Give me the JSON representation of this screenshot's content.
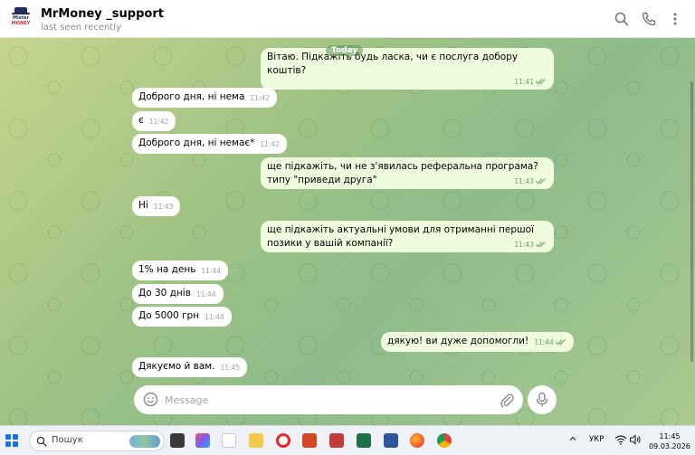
{
  "header": {
    "avatar_text_top": "Mister",
    "avatar_text_bottom": "MONEY",
    "title": "MrMoney _support",
    "status": "last seen recently"
  },
  "chat": {
    "date_chip": "Today",
    "messages": [
      {
        "dir": "out",
        "text": "Вітаю. Підкажіть будь ласка, чи є послуга добору коштів?",
        "time": "11:41"
      },
      {
        "dir": "in",
        "text": "Доброго дня, ні нема",
        "time": "11:42"
      },
      {
        "dir": "in",
        "text": "є",
        "time": "11:42"
      },
      {
        "dir": "in",
        "text": "Доброго дня, ні немає*",
        "time": "11:42"
      },
      {
        "dir": "out",
        "text": "ще підкажіть, чи не з'явилась реферальна програма? типу \"приведи друга\"",
        "time": "11:43"
      },
      {
        "dir": "in",
        "text": "Ні",
        "time": "11:43"
      },
      {
        "dir": "out",
        "text": "ще підкажіть актуальні умови для отриманні першої позики у вашій компанії?",
        "time": "11:43"
      },
      {
        "dir": "in",
        "text": "1% на день",
        "time": "11:44"
      },
      {
        "dir": "in",
        "text": "До 30 днів",
        "time": "11:44"
      },
      {
        "dir": "in",
        "text": "До 5000 грн",
        "time": "11:44"
      },
      {
        "dir": "out",
        "text": "дякую! ви дуже допомогли!",
        "time": "11:44"
      },
      {
        "dir": "in",
        "text": "Дякуємо й вам.",
        "time": "11:45"
      }
    ]
  },
  "composer": {
    "placeholder": "Message"
  },
  "taskbar": {
    "search_placeholder": "Пошук",
    "language": "УКР",
    "time": "11:45",
    "date": "09.03.2026"
  },
  "colors": {
    "outgoing_bubble": "#effdde",
    "incoming_bubble": "#ffffff",
    "read_ticks": "#5fa85b",
    "accent": "#3390ec"
  },
  "icons": [
    "search-icon",
    "phone-icon",
    "more-vertical-icon",
    "smile-icon",
    "paperclip-icon",
    "microphone-icon",
    "windows-start-icon"
  ]
}
